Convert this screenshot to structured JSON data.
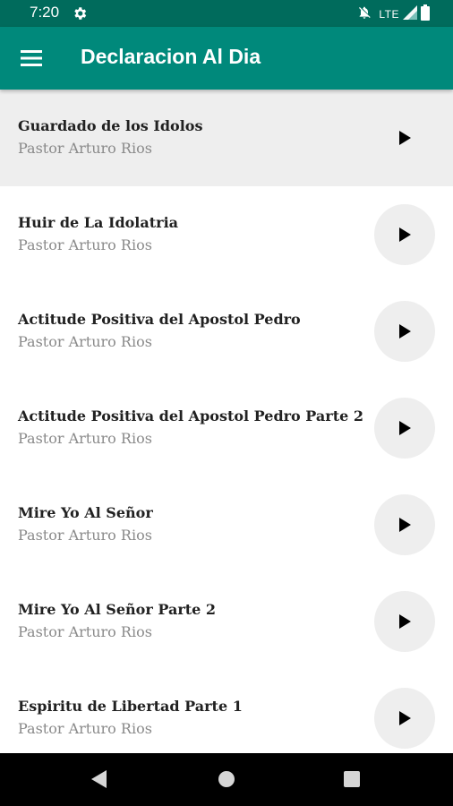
{
  "status_bar": {
    "time": "7:20",
    "network": "LTE",
    "icons": [
      "settings-icon",
      "notifications-off-icon",
      "signal-icon",
      "battery-icon"
    ]
  },
  "app_bar": {
    "title": "Declaracion Al Dia",
    "menu_icon": "hamburger-menu-icon",
    "color": "#00897b"
  },
  "sermons": [
    {
      "title": "Guardado de los Idolos",
      "author": "Pastor Arturo Rios",
      "selected": true
    },
    {
      "title": "Huir de La Idolatria",
      "author": "Pastor Arturo Rios",
      "selected": false
    },
    {
      "title": "Actitude Positiva del Apostol Pedro",
      "author": "Pastor Arturo Rios",
      "selected": false
    },
    {
      "title": "Actitude Positiva del Apostol Pedro Parte 2",
      "author": "Pastor Arturo Rios",
      "selected": false
    },
    {
      "title": "Mire Yo Al Señor",
      "author": "Pastor Arturo Rios",
      "selected": false
    },
    {
      "title": "Mire Yo Al Señor Parte 2",
      "author": "Pastor Arturo Rios",
      "selected": false
    },
    {
      "title": "Espiritu de Libertad Parte 1",
      "author": "Pastor Arturo Rios",
      "selected": false
    }
  ],
  "nav_bar": {
    "icons": [
      "back-icon",
      "home-icon",
      "recents-icon"
    ]
  }
}
